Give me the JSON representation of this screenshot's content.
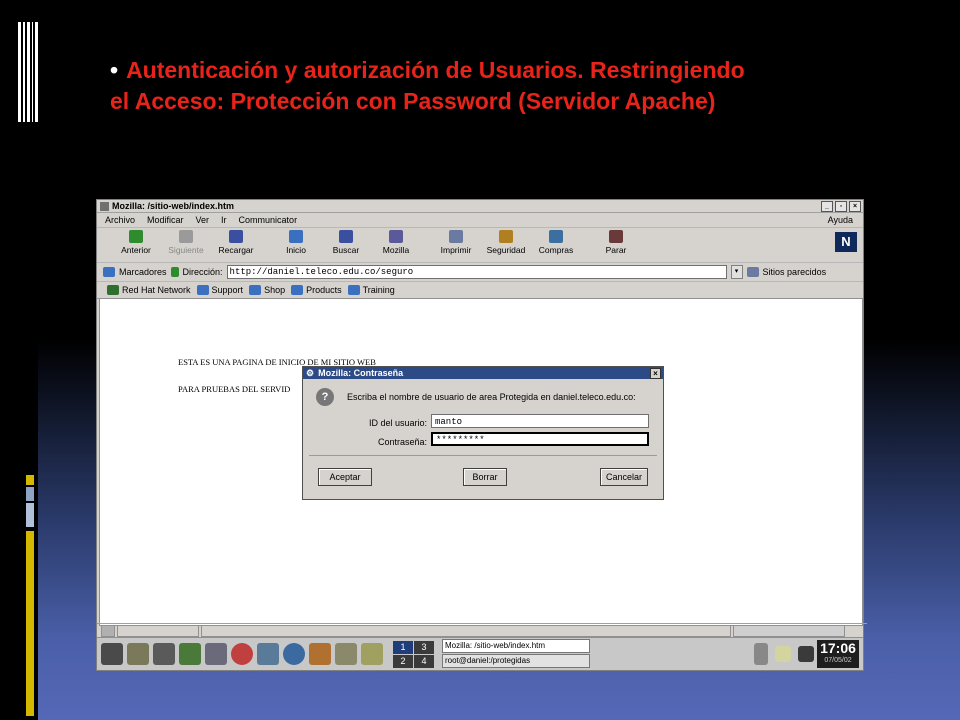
{
  "slide": {
    "bullet": "•",
    "title_line1": "Autenticación y autorización de Usuarios. Restringiendo",
    "title_line2": "el Acceso: Protección con Password (Servidor Apache)",
    "title_color": "#e8231a"
  },
  "window": {
    "title": "Mozilla: /sitio-web/index.htm"
  },
  "menu": {
    "items": [
      "Archivo",
      "Modificar",
      "Ver",
      "Ir",
      "Communicator"
    ],
    "help": "Ayuda"
  },
  "toolbar": {
    "buttons": [
      {
        "label": "Anterior",
        "icon": "back-arrow-icon",
        "color": "#2e8b2e",
        "enabled": true
      },
      {
        "label": "Siguiente",
        "icon": "forward-arrow-icon",
        "color": "#9a9a9a",
        "enabled": false
      },
      {
        "label": "Recargar",
        "icon": "reload-icon",
        "color": "#3b4fa0",
        "enabled": true
      },
      {
        "label": "Inicio",
        "icon": "home-icon",
        "color": "#3b6fc0",
        "enabled": true
      },
      {
        "label": "Buscar",
        "icon": "search-icon",
        "color": "#3b4fa0",
        "enabled": true
      },
      {
        "label": "Mozilla",
        "icon": "mozilla-icon",
        "color": "#5a5a9a",
        "enabled": true
      },
      {
        "label": "Imprimir",
        "icon": "print-icon",
        "color": "#6a7aa0",
        "enabled": true
      },
      {
        "label": "Seguridad",
        "icon": "lock-icon",
        "color": "#b08020",
        "enabled": true
      },
      {
        "label": "Compras",
        "icon": "shop-icon",
        "color": "#3b6fa0",
        "enabled": true
      },
      {
        "label": "Parar",
        "icon": "stop-icon",
        "color": "#6a3a3a",
        "enabled": true
      }
    ],
    "logo": "N"
  },
  "location": {
    "bookmarks_label": "Marcadores",
    "address_label": "Dirección:",
    "url": "http://daniel.teleco.edu.co/seguro",
    "related_label": "Sitios parecidos"
  },
  "bookmarks": [
    "Red Hat Network",
    "Support",
    "Shop",
    "Products",
    "Training"
  ],
  "page": {
    "line1": "ESTA ES UNA PAGINA DE INICIO DE MI SITIO WEB",
    "line2": "PARA PRUEBAS DEL SERVID"
  },
  "dialog": {
    "title": "Mozilla: Contraseña",
    "message": "Escriba el nombre de usuario de area Protegida en daniel.teleco.edu.co:",
    "user_label": "ID del usuario:",
    "user_value": "manto",
    "password_label": "Contraseña:",
    "password_value": "*********",
    "accept": "Aceptar",
    "clear": "Borrar",
    "cancel": "Cancelar",
    "title_bg": "#2c4a86"
  },
  "taskbar": {
    "pager": [
      "1",
      "3",
      "2",
      "4"
    ],
    "tasks": [
      "Mozilla: /sitio-web/index.htm",
      "root@daniel:/protegidas"
    ],
    "clock_time": "17:06",
    "clock_date": "07/05/02"
  }
}
